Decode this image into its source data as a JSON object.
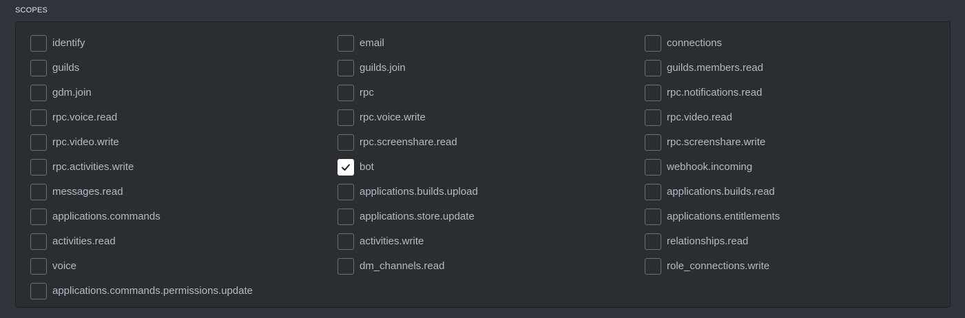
{
  "section": {
    "title": "SCOPES"
  },
  "colors": {
    "background": "#313338",
    "panel": "#2b2d31",
    "label": "#b5bac1",
    "checkbox_border": "#6d6f78",
    "checked_fill": "#ffffff"
  },
  "scopes": [
    {
      "label": "identify",
      "checked": false
    },
    {
      "label": "email",
      "checked": false
    },
    {
      "label": "connections",
      "checked": false
    },
    {
      "label": "guilds",
      "checked": false
    },
    {
      "label": "guilds.join",
      "checked": false
    },
    {
      "label": "guilds.members.read",
      "checked": false
    },
    {
      "label": "gdm.join",
      "checked": false
    },
    {
      "label": "rpc",
      "checked": false
    },
    {
      "label": "rpc.notifications.read",
      "checked": false
    },
    {
      "label": "rpc.voice.read",
      "checked": false
    },
    {
      "label": "rpc.voice.write",
      "checked": false
    },
    {
      "label": "rpc.video.read",
      "checked": false
    },
    {
      "label": "rpc.video.write",
      "checked": false
    },
    {
      "label": "rpc.screenshare.read",
      "checked": false
    },
    {
      "label": "rpc.screenshare.write",
      "checked": false
    },
    {
      "label": "rpc.activities.write",
      "checked": false
    },
    {
      "label": "bot",
      "checked": true
    },
    {
      "label": "webhook.incoming",
      "checked": false
    },
    {
      "label": "messages.read",
      "checked": false
    },
    {
      "label": "applications.builds.upload",
      "checked": false
    },
    {
      "label": "applications.builds.read",
      "checked": false
    },
    {
      "label": "applications.commands",
      "checked": false
    },
    {
      "label": "applications.store.update",
      "checked": false
    },
    {
      "label": "applications.entitlements",
      "checked": false
    },
    {
      "label": "activities.read",
      "checked": false
    },
    {
      "label": "activities.write",
      "checked": false
    },
    {
      "label": "relationships.read",
      "checked": false
    },
    {
      "label": "voice",
      "checked": false
    },
    {
      "label": "dm_channels.read",
      "checked": false
    },
    {
      "label": "role_connections.write",
      "checked": false
    },
    {
      "label": "applications.commands.permissions.update",
      "checked": false
    }
  ]
}
